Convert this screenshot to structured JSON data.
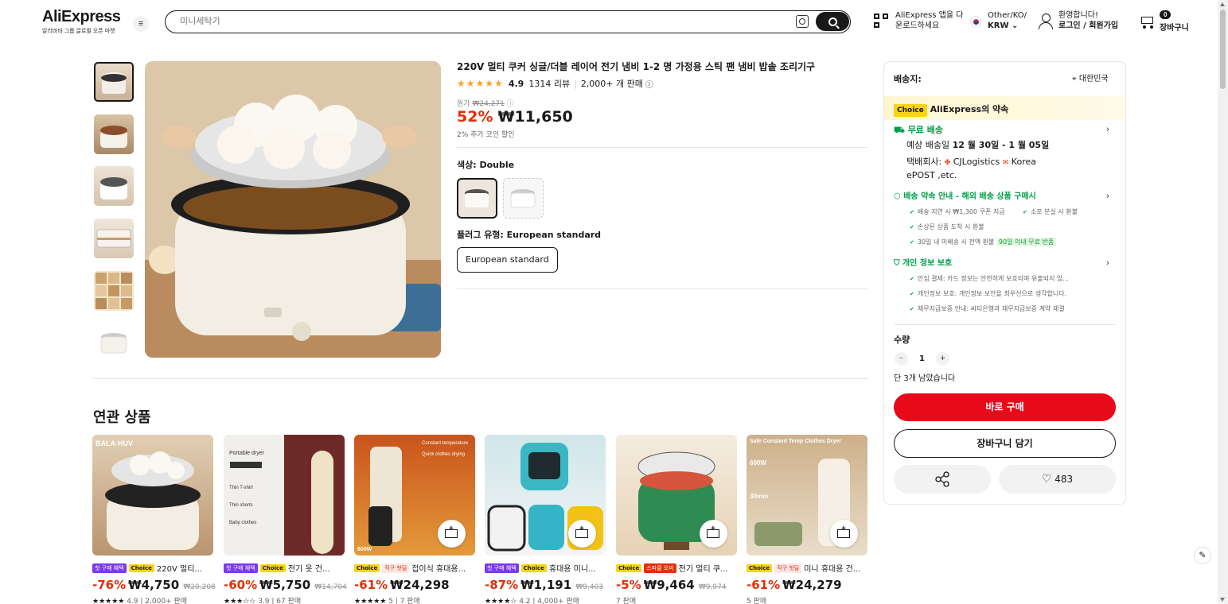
{
  "header": {
    "logo": "AliExpress",
    "logo_sub": "알리바바 그룹 글로벌 오픈 마켓",
    "search_placeholder": "미니세탁기",
    "app_line1": "AliExpress 앱을 다",
    "app_line2": "운로드하세요",
    "region_line1": "Other/KO/",
    "region_line2": "KRW",
    "user_line1": "환영합니다!",
    "user_line2": "로그인 / 회원가입",
    "cart_count": "0",
    "cart_label": "장바구니"
  },
  "product": {
    "title": "220V 멀티 쿠커 싱글/더블 레이어 전기 냄비 1-2 명 가정용 스틱 팬 냄비 밥솥 조리기구",
    "rating": "4.9",
    "reviews": "1314 리뷰",
    "sold": "2,000+ 개 판매",
    "orig_label": "원가",
    "orig_price": "₩24,271",
    "discount": "52%",
    "price": "₩11,650",
    "coin_note": "2% 추가 코인 할인",
    "color_label": "색상: Double",
    "plug_label": "플러그 유형: European standard",
    "plug_option": "European standard"
  },
  "panel": {
    "ship_to_label": "배송지:",
    "ship_to_value": "대한민국",
    "choice_tag": "Choice",
    "promise": "AliExpress의 약속",
    "free_ship": "무료 배송",
    "eta_prefix": "예상 배송일",
    "eta": "12 월 30일 - 1 월 05일",
    "carrier_prefix": "택배회사:",
    "carrier1": "CJLogistics",
    "carrier2": "Korea",
    "carrier3": "ePOST ,etc.",
    "guarantee_title": "배송 약속 안내 - 해외 배송 상품 구매시",
    "g1": "배송 지연 시 ₩1,300 쿠폰 지급",
    "g2": "소포 분실 시 환불",
    "g3": "손상된 상품 도착 시 환불",
    "g4": "30일 내 미배송 시 전액 환불",
    "g4_badge": "90일 이내 무료 반품",
    "privacy_title": "개인 정보 보호",
    "p1": "안심 결제: 카드 정보는 안전하게 보호되며 유출되지 않...",
    "p2": "개인정보 보호: 개인정보 보안을 최우선으로 생각합니다.",
    "p3": "채무지급보증 안내: 씨티은행과 채무지급보증 계약 체결",
    "qty_label": "수량",
    "qty": "1",
    "stock": "단 3개 남았습니다",
    "buy_now": "바로 구매",
    "add_cart": "장바구니 담기",
    "wish_count": "483"
  },
  "related": {
    "title": "연관 상품",
    "items": [
      {
        "tag1": "첫 구매 혜택",
        "tag2": "Choice",
        "name": "220V 멀티...",
        "discount": "-76%",
        "price": "₩4,750",
        "orig": "₩20,208",
        "meta": "4.9 | 2,000+ 판매"
      },
      {
        "tag1": "첫 구매 혜택",
        "tag2": "Choice",
        "name": "전기 옷 건...",
        "discount": "-60%",
        "price": "₩5,750",
        "orig": "₩14,704",
        "meta": "3.9 | 67 판매"
      },
      {
        "tag1": "Choice",
        "tag2": "직구 핫딜",
        "name": "접이식 휴대용...",
        "discount": "-61%",
        "price": "₩24,298",
        "orig": "",
        "meta": "5 | 7 판매"
      },
      {
        "tag1": "첫 구매 혜택",
        "tag2": "Choice",
        "name": "휴대용 미니...",
        "discount": "-87%",
        "price": "₩1,191",
        "orig": "₩9,403",
        "meta": "4.2 | 4,000+ 판매"
      },
      {
        "tag1": "Choice",
        "tag2": "스파클 오퍼",
        "name": "전기 멀티 쿠...",
        "discount": "-5%",
        "price": "₩9,464",
        "orig": "₩9,974",
        "meta": "7 판매"
      },
      {
        "tag1": "Choice",
        "tag2": "직구 핫딜",
        "name": "미니 휴대용 건...",
        "discount": "-61%",
        "price": "₩24,279",
        "orig": "",
        "meta": "5 판매"
      }
    ]
  }
}
